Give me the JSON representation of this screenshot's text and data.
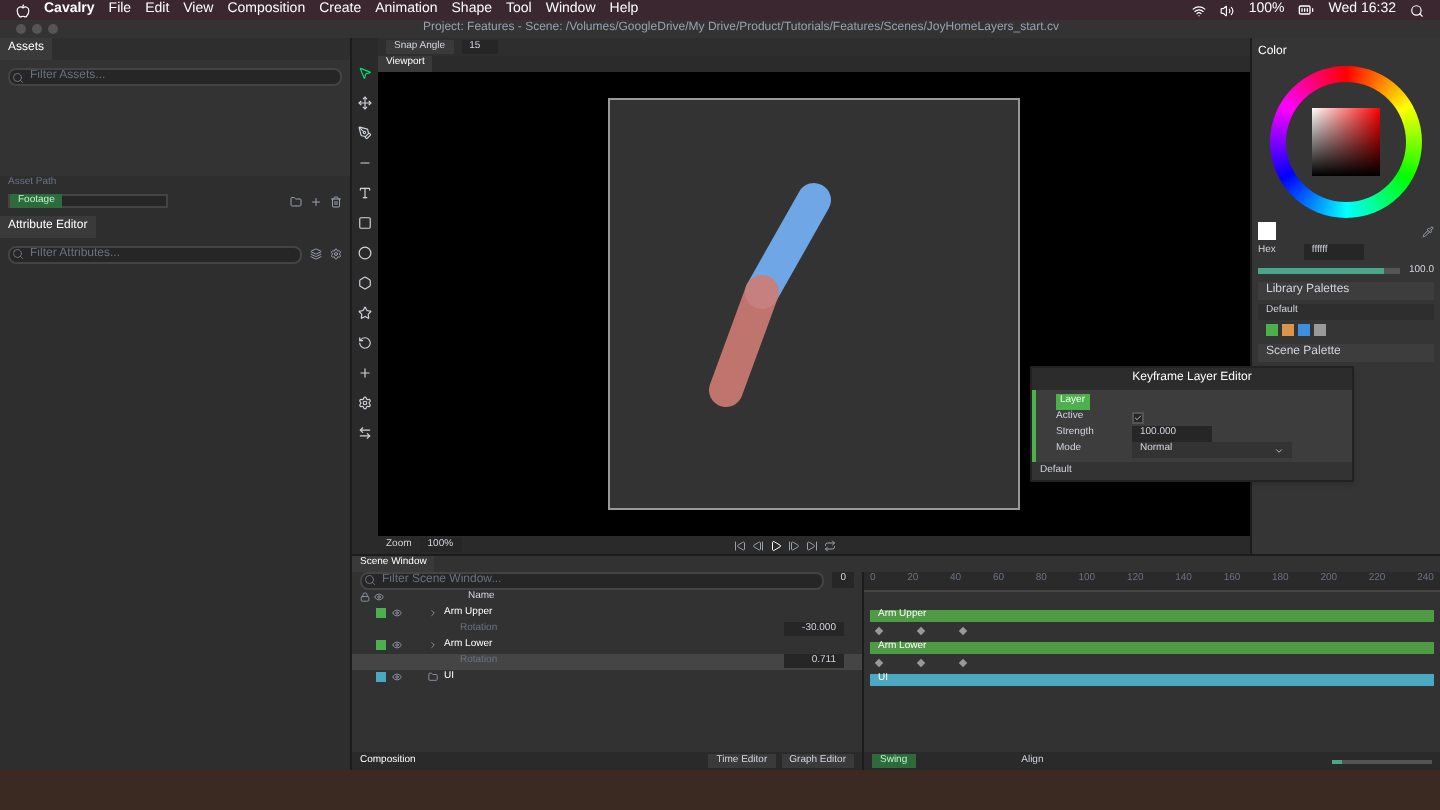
{
  "menu_bar": {
    "app": "Cavalry",
    "items": [
      "File",
      "Edit",
      "View",
      "Composition",
      "Create",
      "Animation",
      "Shape",
      "Tool",
      "Window",
      "Help"
    ],
    "battery": "100%",
    "clock": "Wed 16:32"
  },
  "window": {
    "title": "Project: Features - Scene: /Volumes/GoogleDrive/My Drive/Product/Tutorials/Features/Scenes/JoyHomeLayers_start.cv"
  },
  "assets": {
    "tab": "Assets",
    "search": {
      "placeholder": "Filter Assets..."
    },
    "path_label": "Asset Path",
    "path_value": "Footage"
  },
  "attribute_editor": {
    "tab": "Attribute Editor",
    "search": {
      "placeholder": "Filter Attributes..."
    }
  },
  "toolbar": {
    "snap_label": "Snap Angle",
    "snap_value": "15"
  },
  "viewport": {
    "tab": "Viewport",
    "zoom_label": "Zoom",
    "zoom_value": "100%"
  },
  "color_panel": {
    "tab": "Color",
    "hex_label": "Hex",
    "hex_value": "ffffff",
    "slider": {
      "level": 0.88,
      "reading": "100.0"
    }
  },
  "library_palettes": {
    "title": "Library Palettes",
    "palette": "Default",
    "swatches": [
      {
        "color": "#4cb04c"
      },
      {
        "color": "#d9964a"
      },
      {
        "color": "#3d8fe0"
      },
      {
        "color": "#9a9a9a"
      }
    ]
  },
  "scene_palette": {
    "title": "Scene Palette"
  },
  "keyframe_layer_editor": {
    "title": "Keyframe Layer Editor",
    "layer": "Layer",
    "fields": [
      {
        "label": "Active",
        "kind": "checkbox",
        "checked": true
      },
      {
        "label": "Strength",
        "kind": "number",
        "value": "100.000"
      },
      {
        "label": "Mode",
        "kind": "select",
        "value": "Normal"
      }
    ],
    "footer": "Default"
  },
  "scene_window": {
    "tab": "Scene Window",
    "search": {
      "placeholder": "Filter Scene Window..."
    },
    "current_frame": "0",
    "name_header": "Name",
    "rows": [
      {
        "kind": "layer",
        "name": "Arm Upper",
        "color": "#4cb04c",
        "selected": false
      },
      {
        "kind": "attribute",
        "name": "Rotation",
        "value": "-30.000",
        "selected": false
      },
      {
        "kind": "layer",
        "name": "Arm Lower",
        "color": "#4cb04c",
        "selected": false
      },
      {
        "kind": "attribute",
        "name": "Rotation",
        "value": "0.711",
        "selected": true
      },
      {
        "kind": "folder",
        "name": "UI",
        "color": "#4aa8c0",
        "selected": false
      }
    ],
    "composition": "Composition",
    "tabs": [
      {
        "label": "Time Editor",
        "selected": false
      },
      {
        "label": "Graph Editor",
        "selected": false
      }
    ]
  },
  "timeline": {
    "ticks": [
      "0",
      "20",
      "40",
      "60",
      "80",
      "100",
      "120",
      "140",
      "160",
      "180",
      "200",
      "220",
      "240"
    ],
    "tracks": [
      {
        "kind": "bar",
        "label": "Arm Upper",
        "color": "#4f9a45"
      },
      {
        "kind": "keys"
      },
      {
        "kind": "bar",
        "label": "Arm Lower",
        "color": "#4f9a45"
      },
      {
        "kind": "keys"
      },
      {
        "kind": "bar",
        "label": "UI",
        "color": "#4aa8c0"
      }
    ],
    "easing": "Swing",
    "align_label": "Align",
    "zoom_slider": {
      "level": 0.1
    }
  }
}
